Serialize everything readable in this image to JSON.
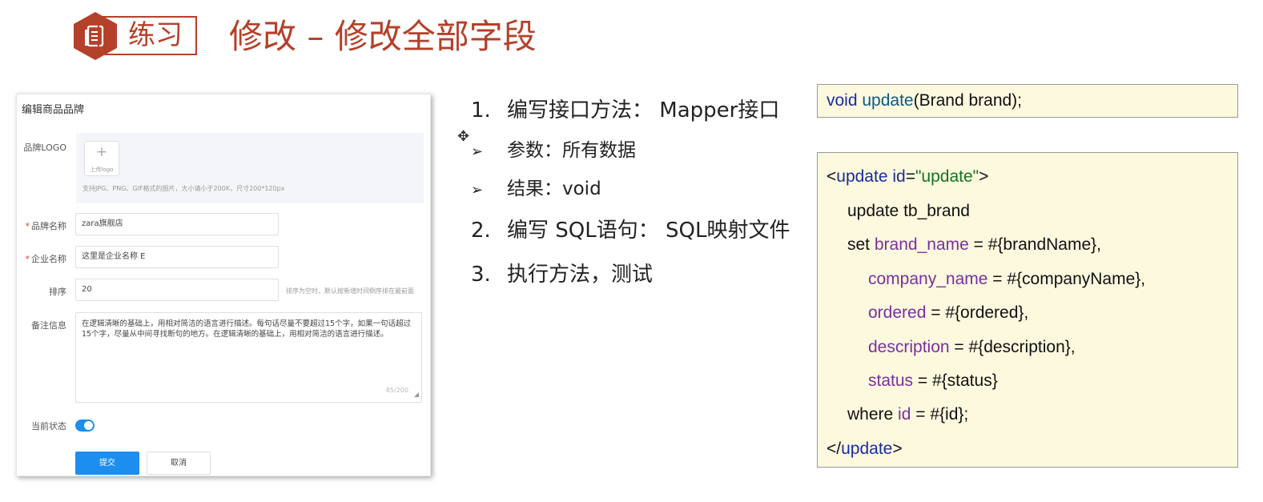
{
  "header": {
    "badge_label": "练习",
    "title": "修改 – 修改全部字段",
    "badge_icon": "document-icon",
    "accent_color": "#b5402a"
  },
  "form": {
    "title": "编辑商品品牌",
    "logo_label": "品牌LOGO",
    "upload_text": "上传logo",
    "logo_hint": "支持JPG、PNG、GIF格式的图片，大小请小于200K，尺寸200*120px",
    "brand_name_label": "品牌名称",
    "brand_name_value": "zara旗舰店",
    "company_name_label": "企业名称",
    "company_name_value": "这里是企业名称 E",
    "ordered_label": "排序",
    "ordered_value": "20",
    "ordered_hint": "排序为空时，默认按新增时间倒序排在最前面",
    "description_label": "备注信息",
    "description_value": "在逻辑清晰的基础上，用相对简洁的语言进行描述。每句话尽量不要超过15个字，如果一句话超过15个字，尽量从中间寻找断句的地方。在逻辑清晰的基础上，用相对简洁的语言进行描述。",
    "description_counter": "85/200",
    "status_label": "当前状态",
    "status_on": true,
    "submit_label": "提交",
    "cancel_label": "取消",
    "required_mark": "*",
    "primary_color": "#1b8ef0"
  },
  "steps": {
    "step1_num": "1.",
    "step1_text": "编写接口方法： Mapper接口",
    "sub1_arrow": "➢",
    "sub1_text": "参数：所有数据",
    "sub2_arrow": "➢",
    "sub2_text": "结果：void",
    "step2_num": "2.",
    "step2_text": "编写 SQL语句： SQL映射文件",
    "step3_num": "3.",
    "step3_text": "执行方法，测试"
  },
  "code1": {
    "kw_void": "void",
    "fn_update": "update",
    "rest": "(Brand brand);"
  },
  "code2": {
    "open_lt": "<",
    "open_tag": "update",
    "attr_name": "id",
    "attr_eq": "=",
    "attr_value": "\"update\"",
    "open_gt": ">",
    "line2": "update tb_brand",
    "line3_set": "set",
    "line3_field": "brand_name",
    "line3_rest": "= #{brandName},",
    "line4_field": "company_name",
    "line4_rest": "= #{companyName},",
    "line5_field": "ordered",
    "line5_rest": "= #{ordered},",
    "line6_field": "description",
    "line6_rest": "= #{description},",
    "line7_field": "status",
    "line7_rest": "= #{status}",
    "line8_where": "where",
    "line8_field": "id",
    "line8_rest": "= #{id};",
    "close_lt": "</",
    "close_tag": "update",
    "close_gt": ">",
    "bg_color": "#fcf9df"
  }
}
